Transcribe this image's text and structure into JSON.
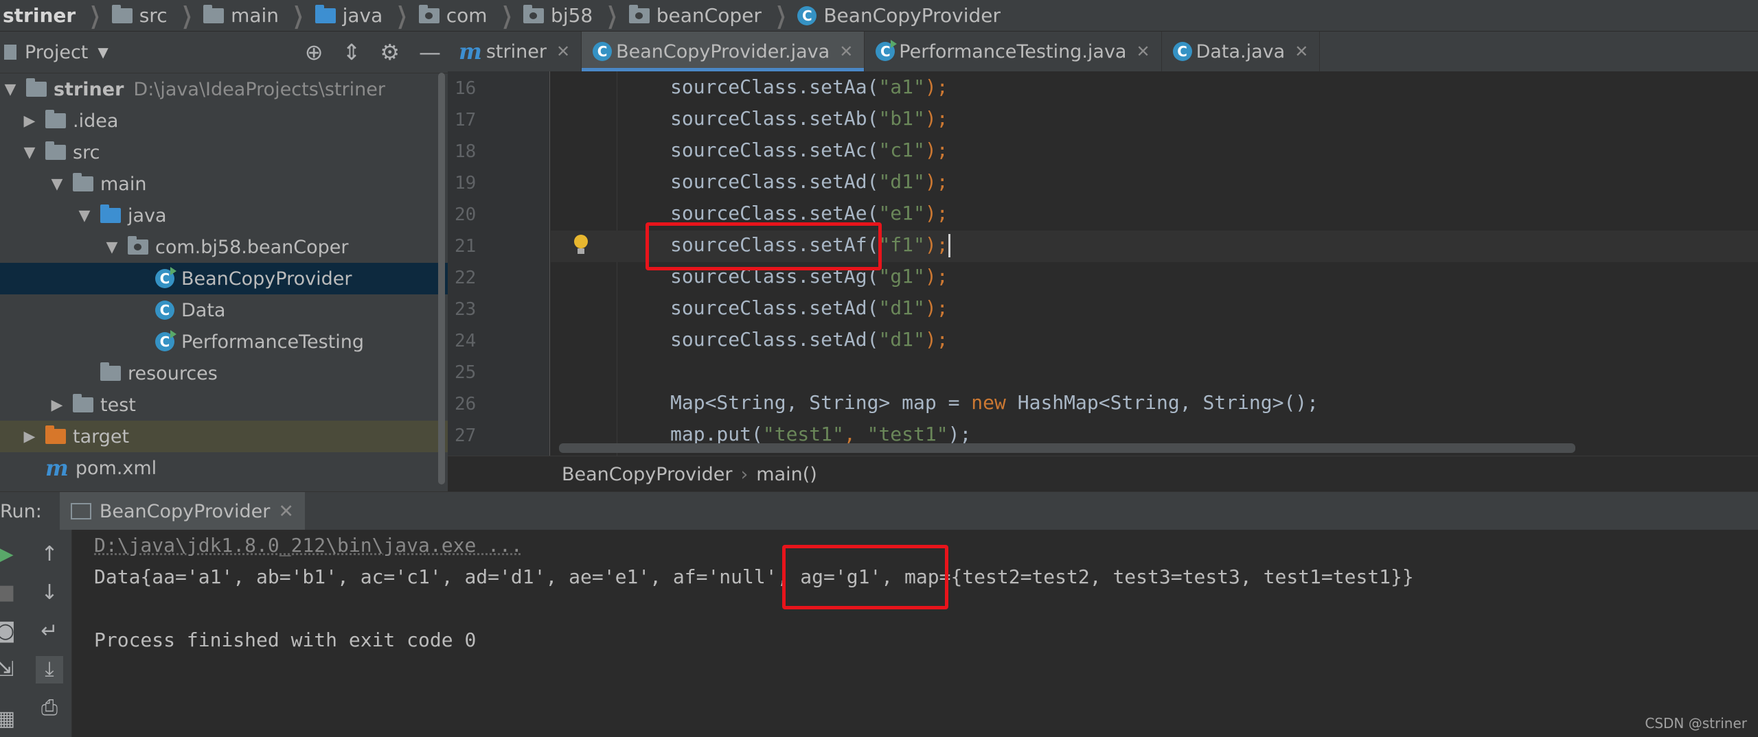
{
  "breadcrumb": {
    "items": [
      {
        "label": "striner",
        "icon": "none"
      },
      {
        "label": "src",
        "icon": "folder-icon"
      },
      {
        "label": "main",
        "icon": "folder-icon"
      },
      {
        "label": "java",
        "icon": "folder-blue-icon"
      },
      {
        "label": "com",
        "icon": "package-icon"
      },
      {
        "label": "bj58",
        "icon": "package-icon"
      },
      {
        "label": "beanCoper",
        "icon": "package-icon"
      },
      {
        "label": "BeanCopyProvider",
        "icon": "class-icon"
      }
    ]
  },
  "project": {
    "title": "Project",
    "tree": [
      {
        "label": "striner",
        "hint": "D:\\java\\IdeaProjects\\striner",
        "depth": 0,
        "arrow": "▼",
        "icon": "module"
      },
      {
        "label": ".idea",
        "hint": "",
        "depth": 1,
        "arrow": "▶",
        "icon": "folder"
      },
      {
        "label": "src",
        "hint": "",
        "depth": 1,
        "arrow": "▼",
        "icon": "folder"
      },
      {
        "label": "main",
        "hint": "",
        "depth": 2,
        "arrow": "▼",
        "icon": "folder"
      },
      {
        "label": "java",
        "hint": "",
        "depth": 3,
        "arrow": "▼",
        "icon": "folder-blue"
      },
      {
        "label": "com.bj58.beanCoper",
        "hint": "",
        "depth": 4,
        "arrow": "▼",
        "icon": "package"
      },
      {
        "label": "BeanCopyProvider",
        "hint": "",
        "depth": 5,
        "arrow": "",
        "icon": "class-run",
        "selected": true
      },
      {
        "label": "Data",
        "hint": "",
        "depth": 5,
        "arrow": "",
        "icon": "class"
      },
      {
        "label": "PerformanceTesting",
        "hint": "",
        "depth": 5,
        "arrow": "",
        "icon": "class-run"
      },
      {
        "label": "resources",
        "hint": "",
        "depth": 3,
        "arrow": "",
        "icon": "folder-res"
      },
      {
        "label": "test",
        "hint": "",
        "depth": 2,
        "arrow": "▶",
        "icon": "folder"
      },
      {
        "label": "target",
        "hint": "",
        "depth": 1,
        "arrow": "▶",
        "icon": "folder-orange",
        "target": true
      },
      {
        "label": "pom.xml",
        "hint": "",
        "depth": 1,
        "arrow": "",
        "icon": "maven"
      }
    ]
  },
  "tabs": [
    {
      "label": "striner",
      "icon": "maven",
      "active": false
    },
    {
      "label": "BeanCopyProvider.java",
      "icon": "class",
      "active": true
    },
    {
      "label": "PerformanceTesting.java",
      "icon": "class-run",
      "active": false
    },
    {
      "label": "Data.java",
      "icon": "class",
      "active": false
    }
  ],
  "editor": {
    "lines": [
      {
        "no": "16",
        "pre": "sourceClass.setAa(",
        "str": "\"a1\"",
        "post": ");"
      },
      {
        "no": "17",
        "pre": "sourceClass.setAb(",
        "str": "\"b1\"",
        "post": ");"
      },
      {
        "no": "18",
        "pre": "sourceClass.setAc(",
        "str": "\"c1\"",
        "post": ");"
      },
      {
        "no": "19",
        "pre": "sourceClass.setAd(",
        "str": "\"d1\"",
        "post": ");"
      },
      {
        "no": "20",
        "pre": "sourceClass.setAe(",
        "str": "\"e1\"",
        "post": ");"
      },
      {
        "no": "21",
        "pre": "sourceClass.setAf(",
        "str": "\"f1\"",
        "post": ");",
        "current": true
      },
      {
        "no": "22",
        "pre": "sourceClass.setAg(",
        "str": "\"g1\"",
        "post": ");"
      },
      {
        "no": "23",
        "pre": "sourceClass.setAd(",
        "str": "\"d1\"",
        "post": ");"
      },
      {
        "no": "24",
        "pre": "sourceClass.setAd(",
        "str": "\"d1\"",
        "post": ");"
      },
      {
        "no": "25",
        "pre": "",
        "str": "",
        "post": ""
      },
      {
        "no": "26",
        "html": "map"
      },
      {
        "no": "27",
        "html": "put"
      }
    ],
    "line26": {
      "a": "Map<String, String> map = ",
      "kw": "new",
      "b": " HashMap<String, String>();"
    },
    "line27": {
      "a": "map.put(",
      "s1": "\"test1\"",
      "c": ", ",
      "s2": "\"test1\"",
      "d": ");"
    },
    "crumbs": [
      "BeanCopyProvider",
      "main()"
    ]
  },
  "run": {
    "label": "Run:",
    "tab": "BeanCopyProvider",
    "cmd": "D:\\java\\jdk1.8.0_212\\bin\\java.exe ...",
    "output": "Data{aa='a1', ab='b1', ac='c1', ad='d1', ae='e1', af='null', ag='g1', map={test2=test2, test3=test3, test1=test1}}",
    "exit": "Process finished with exit code 0"
  },
  "watermark": "CSDN @striner",
  "colors": {
    "highlight": "#e8141b",
    "accent": "#4a88c7",
    "string": "#6a8759",
    "keyword": "#cc7832"
  }
}
